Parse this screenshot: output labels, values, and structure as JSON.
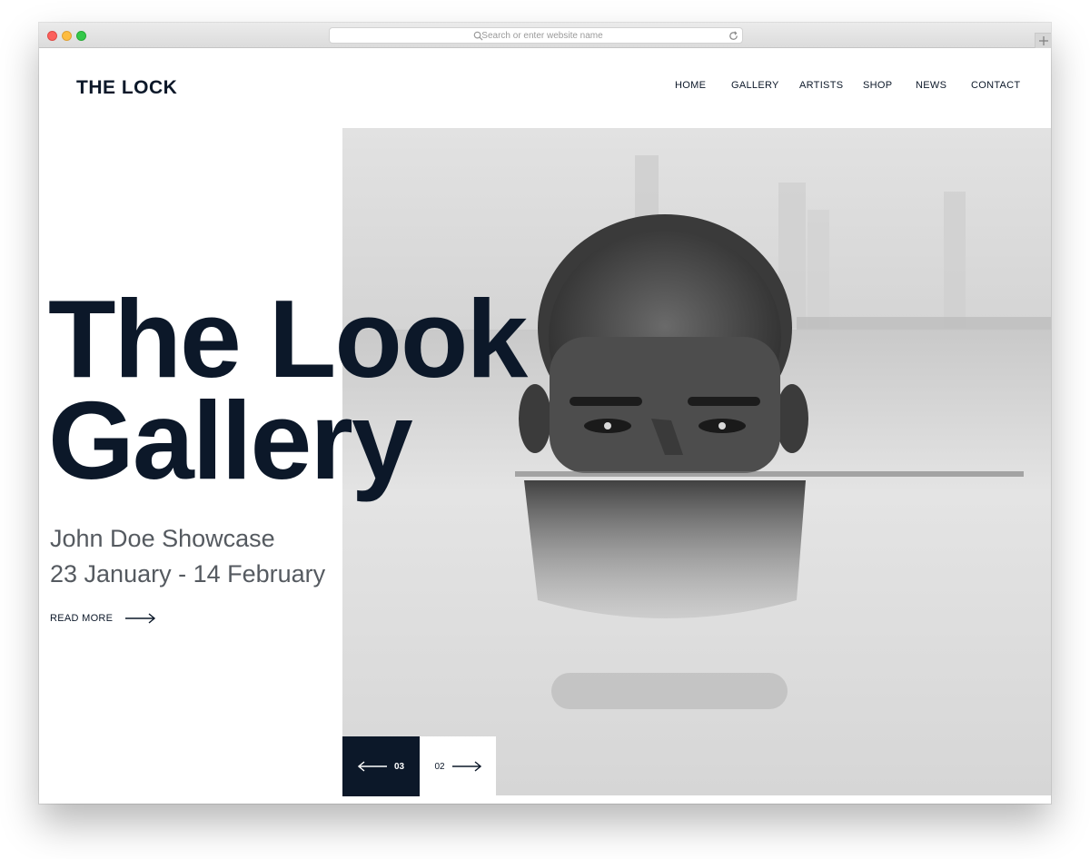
{
  "browser": {
    "url_placeholder": "Search or enter website name"
  },
  "header": {
    "logo": "THE LOCK",
    "nav": [
      {
        "label": "HOME"
      },
      {
        "label": "GALLERY"
      },
      {
        "label": "ARTISTS"
      },
      {
        "label": "SHOP"
      },
      {
        "label": "NEWS"
      },
      {
        "label": "CONTACT"
      }
    ]
  },
  "hero": {
    "title_line1": "The Look",
    "title_line2": "Gallery",
    "subtitle_line1": "John Doe Showcase",
    "subtitle_line2": "23 January - 14 February",
    "read_more": "READ MORE"
  },
  "slider": {
    "prev_number": "03",
    "next_number": "02"
  },
  "colors": {
    "brand_navy": "#0c1829",
    "subtitle_gray": "#555a60"
  }
}
